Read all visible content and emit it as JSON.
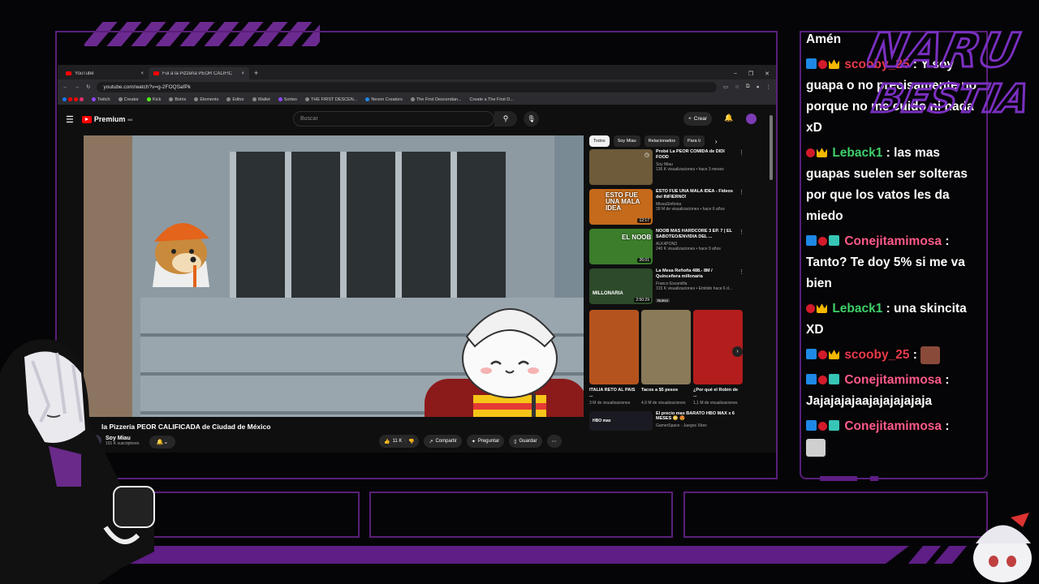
{
  "browser": {
    "tabs": [
      {
        "label": "YouTube",
        "active": false
      },
      {
        "label": "Fui a la Pizzeria PEOR CALIFIC",
        "active": true
      }
    ],
    "new_tab": "+",
    "url": "youtube.com/watch?v=g-2FOQSafPk",
    "bookmarks": [
      "Twitch",
      "Creator",
      "Kick",
      "Botrix",
      "Elements",
      "Editor",
      "Wallet",
      "Sorteo",
      "THE FIRST DESCEN...",
      "Nexon Creators",
      "The First Descendan...",
      "Create a The First D..."
    ]
  },
  "youtube": {
    "logo": "Premium",
    "logo_badge": "MX",
    "search_placeholder": "Buscar",
    "create_label": "Crear",
    "video": {
      "title": "la Pizzería PEOR CALIFICADA de Ciudad de México",
      "channel": "Soy Miau",
      "subscribers": "191 K suscriptores",
      "likes": "11 K",
      "share": "Compartir",
      "ask": "Preguntar",
      "save": "Guardar"
    },
    "chips": [
      "Todos",
      "Soy Miau",
      "Relacionados",
      "Para ti"
    ],
    "suggested": [
      {
        "title": "Probé La PEOR COMIDA de DIDI FOOD",
        "channel": "Soy Miau",
        "views": "136 K visualizaciones • hace 3 meses",
        "duration": "",
        "color": "#6d5b3a"
      },
      {
        "title": "ESTO FUE UNA MALA IDEA - Fideos del INFIERNO!",
        "channel": "MissaSinfonia",
        "views": "39 M de visualizaciones • hace 6 años",
        "duration": "12:17",
        "color": "#c46a1a",
        "thumb_text": "ESTO FUE UNA MALA IDEA"
      },
      {
        "title": "NOOB MAS HARDCORE 3 EP. 7 | EL SABOTEO/ENVIDIA DEL ...",
        "channel": "ALK4PON3",
        "views": "240 K visualizaciones • hace 9 años",
        "duration": "26:01",
        "color": "#3b7d2b",
        "thumb_text": "EL NOOB"
      },
      {
        "title": "La Mesa Reñoña 488.- 8M / Quinceñera millonaria",
        "channel": "Franco Escamilla",
        "views": "315 K visualizaciones • Emitido hace 6 d...",
        "duration": "2:50:29",
        "badge": "Nuevo",
        "color": "#2d4a2a",
        "thumb_text": "MILLONARIA"
      }
    ],
    "shorts": [
      {
        "title": "ITALIA RETÓ AL PAÍS ...",
        "views": "3 M de visualizaciones",
        "color": "#b5531e"
      },
      {
        "title": "Tacos a $5 pesos",
        "views": "4,9 M de visualizaciones",
        "color": "#8a7a5a"
      },
      {
        "title": "¿Por qué el Robin de ...",
        "views": "1,1 M de visualizaciones",
        "color": "#b31d1d"
      }
    ],
    "last": {
      "title": "El precio mas BARATO HBO MAX x 6 MESES 😳 😍",
      "channel": "GamerSpace - Juegos Xbox",
      "thumb_text": "HBO max"
    }
  },
  "chat": {
    "messages": [
      {
        "badges": [],
        "user": "",
        "text": "Amén",
        "user_color": "#ffffff"
      },
      {
        "badges": [
          "prime",
          "red",
          "crown"
        ],
        "user": "scooby_25",
        "text": "Y soy guapa o no precisamente no porque no me cuido ni nada xD",
        "user_color": "#e83a4a"
      },
      {
        "badges": [
          "red",
          "crown"
        ],
        "user": "Leback1",
        "text": "las mas guapas suelen ser solteras por que los vatos les da miedo",
        "user_color": "#3fd06a"
      },
      {
        "badges": [
          "prime",
          "red",
          "teal"
        ],
        "user": "Conejitamimosa",
        "text": "Tanto? Te doy 5% si me va bien",
        "user_color": "#ff5a8a"
      },
      {
        "badges": [
          "red",
          "crown"
        ],
        "user": "Leback1",
        "text": "una skincita XD",
        "user_color": "#3fd06a"
      },
      {
        "badges": [
          "prime",
          "red",
          "crown"
        ],
        "user": "scooby_25",
        "text": "",
        "emote": true,
        "emote_color": "#8a4a3a",
        "user_color": "#e83a4a"
      },
      {
        "badges": [
          "prime",
          "red",
          "teal"
        ],
        "user": "Conejitamimosa",
        "text": "Jajajajajaajajajajajaja",
        "user_color": "#ff5a8a"
      },
      {
        "badges": [
          "prime",
          "red",
          "teal"
        ],
        "user": "Conejitamimosa",
        "text": "",
        "emote": true,
        "emote_color": "#cfcfcf",
        "user_color": "#ff5a8a"
      }
    ],
    "separator": ":"
  },
  "branding": {
    "line1": "NARU",
    "line2": "BESTIA",
    "color": "#7a2fc0"
  },
  "colors": {
    "frame": "#5a1f7a",
    "bar": "#5e1e85"
  }
}
